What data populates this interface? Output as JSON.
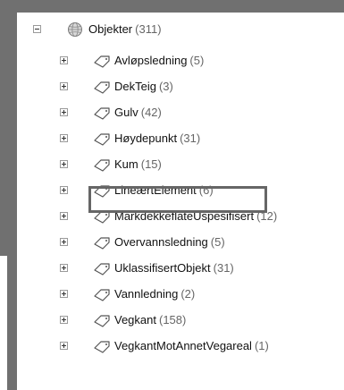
{
  "tree": {
    "root": {
      "label": "Objekter",
      "count": "(311)",
      "icon": "globe-icon",
      "expanded": true
    },
    "items": [
      {
        "label": "Avløpsledning",
        "count": "(5)"
      },
      {
        "label": "DekTeig",
        "count": "(3)"
      },
      {
        "label": "Gulv",
        "count": "(42)"
      },
      {
        "label": "Høydepunkt",
        "count": "(31)"
      },
      {
        "label": "Kum",
        "count": "(15)"
      },
      {
        "label": "LineærtElement",
        "count": "(6)"
      },
      {
        "label": "MarkdekkeflateUspesifisert",
        "count": "(12)"
      },
      {
        "label": "Overvannsledning",
        "count": "(5)"
      },
      {
        "label": "UklassifisertObjekt",
        "count": "(31)"
      },
      {
        "label": "Vannledning",
        "count": "(2)"
      },
      {
        "label": "Vegkant",
        "count": "(158)"
      },
      {
        "label": "VegkantMotAnnetVegareal",
        "count": "(1)"
      }
    ],
    "item_icon": "tag-icon",
    "highlighted_item": "LineærtElement"
  }
}
